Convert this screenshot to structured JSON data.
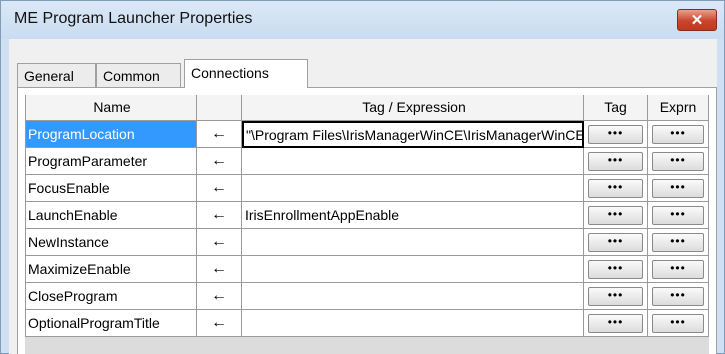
{
  "window": {
    "title": "ME Program Launcher Properties",
    "close_glyph": "✕"
  },
  "tabs": [
    {
      "label": "General",
      "active": false
    },
    {
      "label": "Common",
      "active": false
    },
    {
      "label": "Connections",
      "active": true
    }
  ],
  "grid": {
    "headers": {
      "name": "Name",
      "direction": "",
      "tag_expression": "Tag / Expression",
      "tag": "Tag",
      "expr": "Exprn"
    },
    "browse_label": "•••",
    "arrow_glyph": "←",
    "rows": [
      {
        "name": "ProgramLocation",
        "tag_expression": "\"\\Program Files\\IrisManagerWinCE\\IrisManagerWinCE.exe\"",
        "selected": true
      },
      {
        "name": "ProgramParameter",
        "tag_expression": ""
      },
      {
        "name": "FocusEnable",
        "tag_expression": ""
      },
      {
        "name": "LaunchEnable",
        "tag_expression": "IrisEnrollmentAppEnable"
      },
      {
        "name": "NewInstance",
        "tag_expression": ""
      },
      {
        "name": "MaximizeEnable",
        "tag_expression": ""
      },
      {
        "name": "CloseProgram",
        "tag_expression": ""
      },
      {
        "name": "OptionalProgramTitle",
        "tag_expression": ""
      }
    ]
  },
  "colors": {
    "selection": "#3399ff",
    "title_bar": "#cfe0f3",
    "close_button": "#c8452d"
  },
  "icons": {
    "close": "close-icon",
    "arrow": "arrow-left-icon",
    "browse": "ellipsis-icon"
  }
}
